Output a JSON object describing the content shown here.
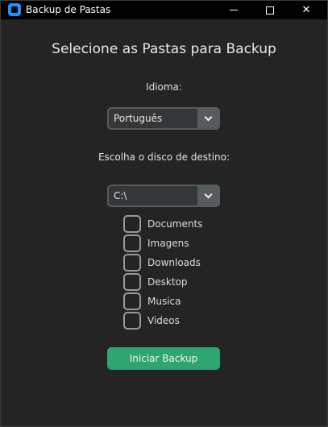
{
  "window": {
    "title": "Backup de Pastas",
    "icon": "app-icon"
  },
  "heading": "Selecione as Pastas para Backup",
  "language": {
    "label": "Idioma:",
    "selected": "Português"
  },
  "disk": {
    "label": "Escolha o disco de destino:",
    "selected": "C:\\"
  },
  "folders": [
    {
      "label": "Documents",
      "checked": false
    },
    {
      "label": "Imagens",
      "checked": false
    },
    {
      "label": "Downloads",
      "checked": false
    },
    {
      "label": "Desktop",
      "checked": false
    },
    {
      "label": "Musica",
      "checked": false
    },
    {
      "label": "Videos",
      "checked": false
    }
  ],
  "start_button": "Iniciar Backup",
  "colors": {
    "background": "#242424",
    "accent": "#2fa572",
    "field": "#343638",
    "field_border": "#565b5e",
    "checkbox_border": "#949a9f"
  }
}
